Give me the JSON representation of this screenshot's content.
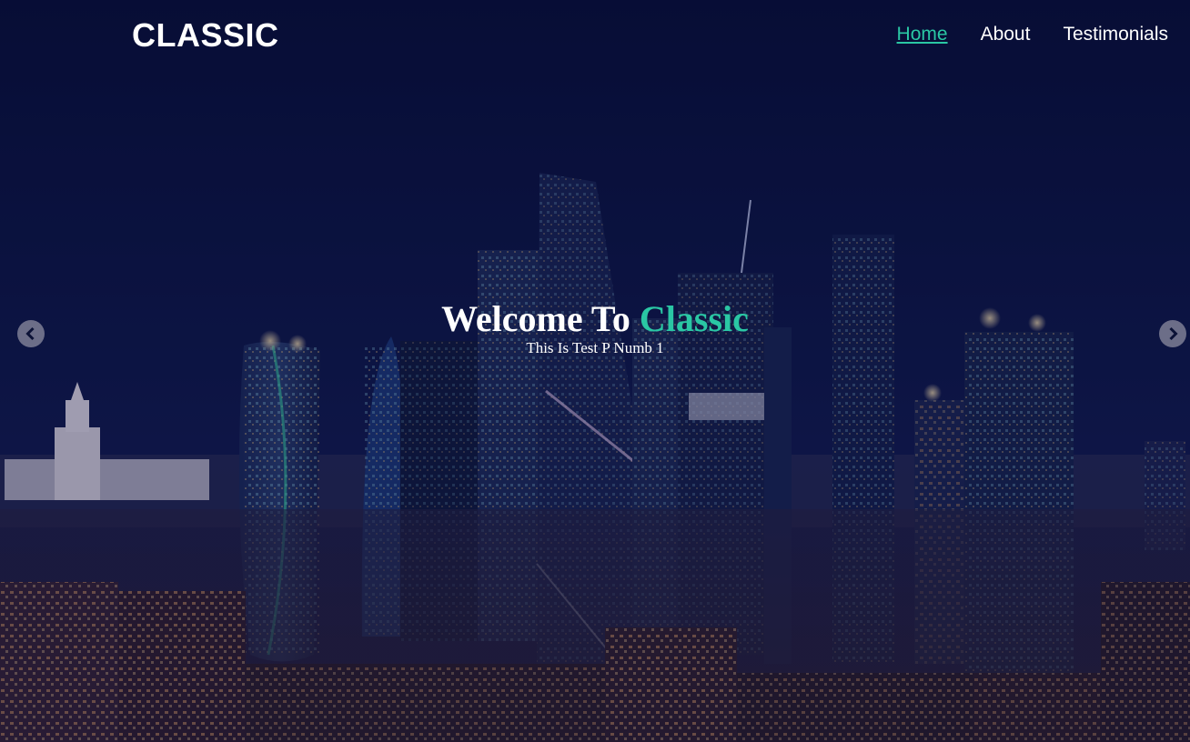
{
  "nav": {
    "logo": "CLASSIC",
    "links": [
      {
        "label": "Home",
        "active": true
      },
      {
        "label": "About",
        "active": false
      },
      {
        "label": "Testimonials",
        "active": false
      }
    ]
  },
  "slider": {
    "title_prefix": "Welcome To ",
    "title_accent": "Classic",
    "subtitle": "This Is Test P Numb 1",
    "prev_icon": "chevron-left-icon",
    "next_icon": "chevron-right-icon"
  },
  "colors": {
    "accent": "#2ac7a4",
    "overlay": "#0b1236"
  }
}
